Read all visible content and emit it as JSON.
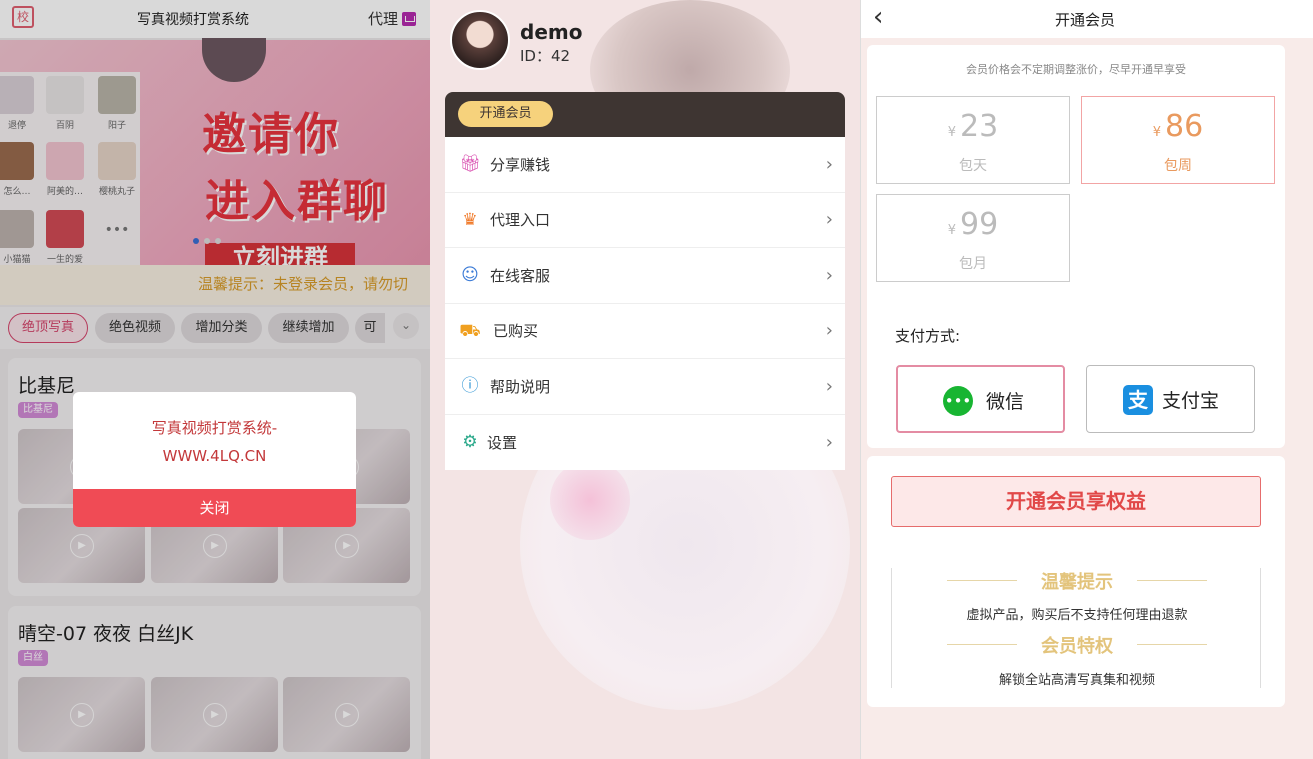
{
  "panel1": {
    "logo": "校",
    "title": "写真视频打赏系统",
    "agent_label": "代理",
    "banner": {
      "chat_contacts": [
        {
          "name": "退停"
        },
        {
          "name": "百阴"
        },
        {
          "name": "阳子"
        },
        {
          "name": "怎么…"
        },
        {
          "name": "阿美的…"
        },
        {
          "name": "樱桃丸子"
        },
        {
          "name": "小猫猫"
        },
        {
          "name": "一生的爱"
        },
        {
          "name": "•••"
        }
      ],
      "line1": "邀请你",
      "line2": "进入群聊",
      "line3": "立刻进群"
    },
    "notice": "温馨提示：未登录会员，请勿切",
    "categories": [
      "绝顶写真",
      "绝色视频",
      "增加分类",
      "继续增加",
      "可"
    ],
    "more_icon": "chevron-down-icon",
    "cards": [
      {
        "title": "比基尼",
        "tag": "比基尼"
      },
      {
        "title": "晴空-07 夜夜 白丝JK",
        "tag": "白丝"
      }
    ],
    "dialog": {
      "message_line1": "写真视频打赏系统-",
      "message_line2": "WWW.4LQ.CN",
      "close": "关闭"
    }
  },
  "panel2": {
    "username": "demo",
    "user_id": "ID：42",
    "vip_button": "开通会员",
    "menu": [
      {
        "label": "分享赚钱",
        "icon": "gift-icon",
        "color": "#d94fb0"
      },
      {
        "label": "代理入口",
        "icon": "crown-icon",
        "color": "#f07a2a"
      },
      {
        "label": "在线客服",
        "icon": "chat-bubble-icon",
        "color": "#3a7ad6"
      },
      {
        "label": "已购买",
        "icon": "cart-icon",
        "color": "#f0a020"
      },
      {
        "label": "帮助说明",
        "icon": "help-icon",
        "color": "#3a9ad6"
      },
      {
        "label": "设置",
        "icon": "gear-icon",
        "color": "#2aa88a"
      }
    ]
  },
  "panel3": {
    "title": "开通会员",
    "price_note": "会员价格会不定期调整涨价，尽早开通早享受",
    "currency": "¥",
    "plans": [
      {
        "amount": "23",
        "name": "包天",
        "selected": false
      },
      {
        "amount": "86",
        "name": "包周",
        "selected": true
      },
      {
        "amount": "99",
        "name": "包月",
        "selected": false
      }
    ],
    "pay_label": "支付方式:",
    "pay_methods": [
      {
        "name": "微信",
        "icon": "wechat-icon",
        "selected": true
      },
      {
        "name": "支付宝",
        "icon": "alipay-icon",
        "selected": false
      }
    ],
    "open_button": "开通会员享权益",
    "tips_title": "温馨提示",
    "tips_text": "虚拟产品，购买后不支持任何理由退款",
    "privileges_title": "会员特权",
    "privileges_text": "解锁全站高清写真集和视频"
  },
  "colors": {
    "accent_pink": "#d5456c",
    "notice_gold": "#d89c2a",
    "dialog_red": "#f04b55",
    "vip_gold": "#f6d27c",
    "price_selected": "#e99a5f",
    "open_button_red": "#e14848"
  }
}
